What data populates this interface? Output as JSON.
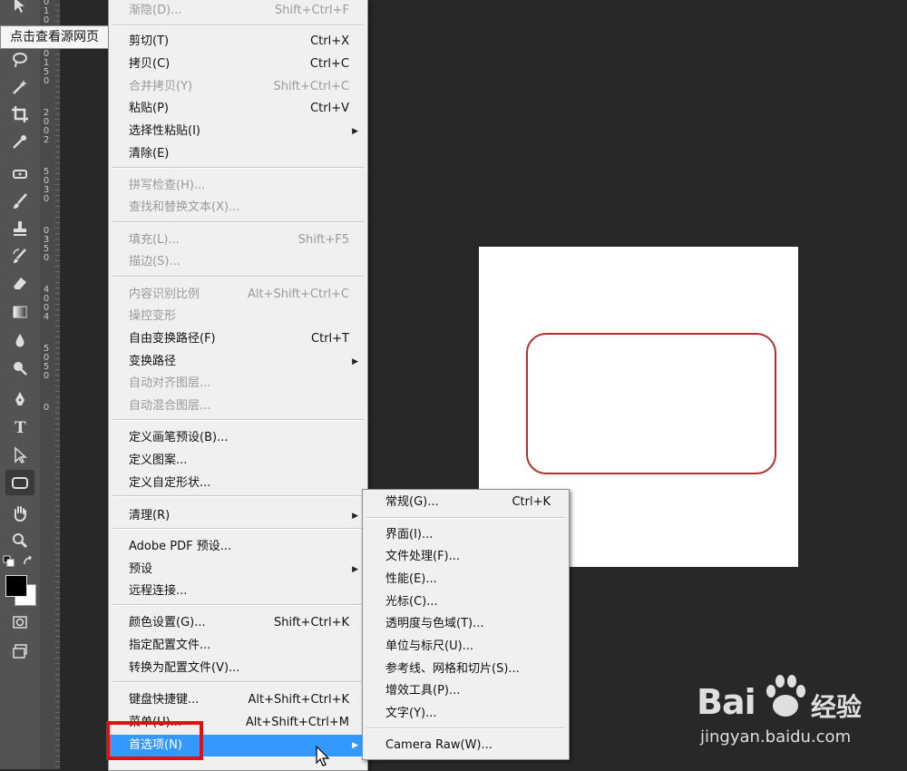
{
  "tooltip": "点击查看源网页",
  "ruler_numbers": [
    "0",
    "1",
    "0",
    "0",
    "1",
    "5",
    "0",
    "2",
    "0",
    "0",
    "2",
    "5",
    "0",
    "3",
    "0",
    "0",
    "3",
    "5",
    "0",
    "4",
    "0",
    "0",
    "4",
    "5",
    "0",
    "5",
    "0",
    "0"
  ],
  "edit_menu": {
    "items": [
      {
        "label": "渐隐(D)...",
        "shortcut": "Shift+Ctrl+F",
        "disabled": true
      },
      {
        "label": "剪切(T)",
        "shortcut": "Ctrl+X"
      },
      {
        "label": "拷贝(C)",
        "shortcut": "Ctrl+C"
      },
      {
        "label": "合并拷贝(Y)",
        "shortcut": "Shift+Ctrl+C",
        "disabled": true
      },
      {
        "label": "粘贴(P)",
        "shortcut": "Ctrl+V"
      },
      {
        "label": "选择性粘贴(I)",
        "arrow": true
      },
      {
        "label": "清除(E)"
      },
      {
        "label": "拼写检查(H)...",
        "disabled": true
      },
      {
        "label": "查找和替换文本(X)...",
        "disabled": true
      },
      {
        "label": "填充(L)...",
        "shortcut": "Shift+F5",
        "disabled": true
      },
      {
        "label": "描边(S)...",
        "disabled": true
      },
      {
        "label": "内容识别比例",
        "shortcut": "Alt+Shift+Ctrl+C",
        "disabled": true
      },
      {
        "label": "操控变形",
        "disabled": true
      },
      {
        "label": "自由变换路径(F)",
        "shortcut": "Ctrl+T"
      },
      {
        "label": "变换路径",
        "arrow": true
      },
      {
        "label": "自动对齐图层...",
        "disabled": true
      },
      {
        "label": "自动混合图层...",
        "disabled": true
      },
      {
        "label": "定义画笔预设(B)..."
      },
      {
        "label": "定义图案..."
      },
      {
        "label": "定义自定形状..."
      },
      {
        "label": "清理(R)",
        "arrow": true
      },
      {
        "label": "Adobe PDF 预设..."
      },
      {
        "label": "预设",
        "arrow": true
      },
      {
        "label": "远程连接..."
      },
      {
        "label": "颜色设置(G)...",
        "shortcut": "Shift+Ctrl+K"
      },
      {
        "label": "指定配置文件..."
      },
      {
        "label": "转换为配置文件(V)..."
      },
      {
        "label": "键盘快捷键...",
        "shortcut": "Alt+Shift+Ctrl+K"
      },
      {
        "label": "菜单(U)...",
        "shortcut": "Alt+Shift+Ctrl+M"
      },
      {
        "label": "首选项(N)",
        "arrow": true,
        "highlighted": true
      }
    ]
  },
  "preferences_submenu": {
    "items": [
      {
        "label": "常规(G)...",
        "shortcut": "Ctrl+K"
      },
      {
        "label": "界面(I)..."
      },
      {
        "label": "文件处理(F)..."
      },
      {
        "label": "性能(E)..."
      },
      {
        "label": "光标(C)..."
      },
      {
        "label": "透明度与色域(T)..."
      },
      {
        "label": "单位与标尺(U)..."
      },
      {
        "label": "参考线、网格和切片(S)..."
      },
      {
        "label": "增效工具(P)..."
      },
      {
        "label": "文字(Y)..."
      },
      {
        "label": "Camera Raw(W)..."
      }
    ]
  },
  "watermark": {
    "brand": "Bai",
    "brand_suffix": "经验",
    "url": "jingyan.baidu.com"
  },
  "colors": {
    "highlight": "#3399ff",
    "shape_stroke": "#b03030",
    "annotation": "#e01010"
  }
}
